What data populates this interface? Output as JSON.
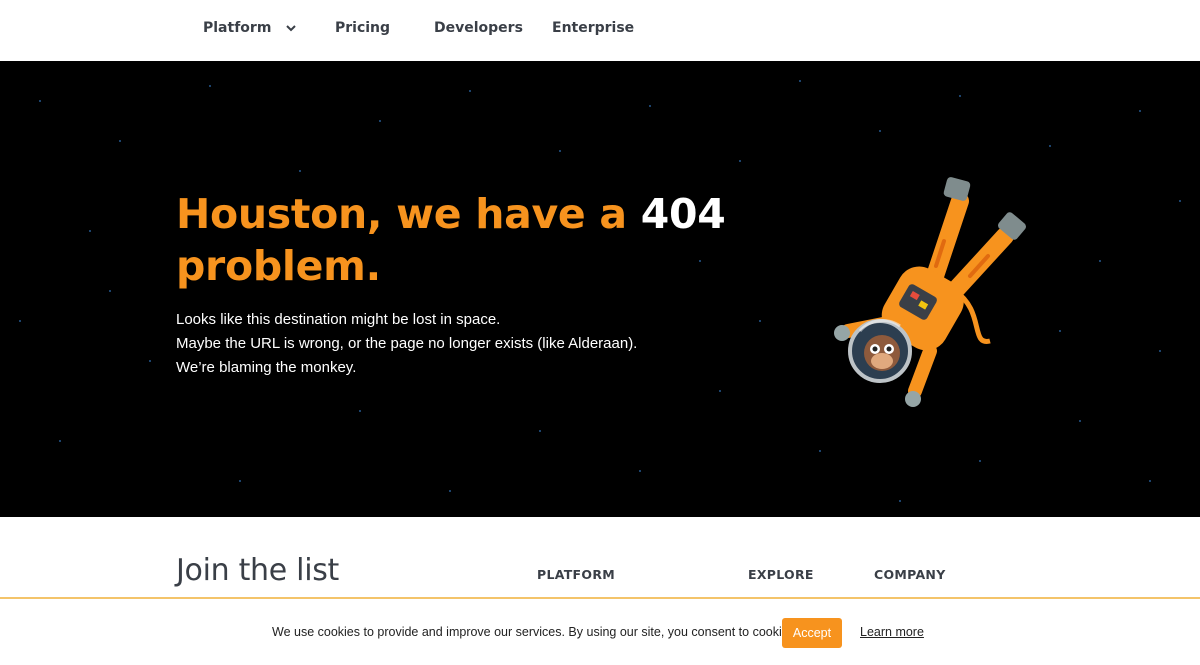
{
  "nav": {
    "items": [
      {
        "label": "Platform"
      },
      {
        "label": "Pricing"
      },
      {
        "label": "Developers"
      },
      {
        "label": "Enterprise"
      }
    ]
  },
  "hero": {
    "headline_orange_1": "Houston, we have a",
    "headline_white": "404",
    "headline_orange_2": "problem.",
    "lines": [
      "Looks like this destination might be lost in space.",
      "Maybe the URL is wrong, or the page no longer exists (like Alderaan).",
      "We’re blaming the monkey."
    ]
  },
  "footer": {
    "join_title": "Join the list",
    "columns": [
      "PLATFORM",
      "EXPLORE",
      "COMPANY"
    ]
  },
  "cookie": {
    "message": "We use cookies to provide and improve our services. By using our site, you consent to cookies.",
    "accept_label": "Accept",
    "learn_more_label": "Learn more"
  },
  "colors": {
    "accent": "#f7931e",
    "text_dark": "#3a3f47",
    "hero_bg": "#000000",
    "cookie_border": "#f4c46a"
  }
}
